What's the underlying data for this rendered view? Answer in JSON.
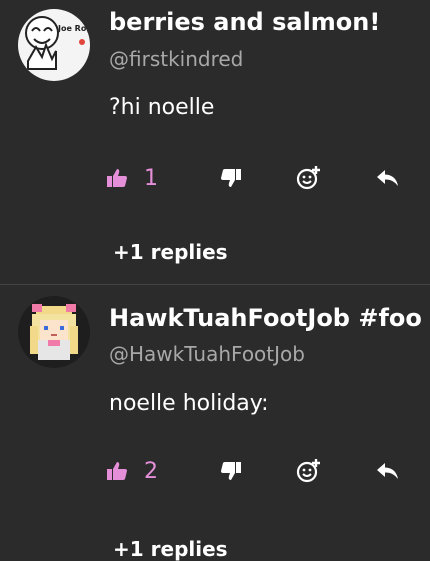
{
  "comments": [
    {
      "name": "berries and salmon!",
      "handle": "@firstkindred",
      "text": "?hi noelle",
      "likes": "1",
      "replies": "+1 replies",
      "avatar_icon": "podcast-logo-avatar",
      "avatar_text": "Joe Rogan Podcast"
    },
    {
      "name": "HawkTuahFootJob #foo",
      "handle": "@HawkTuahFootJob",
      "text": "noelle holiday:",
      "likes": "2",
      "replies": "+1 replies",
      "avatar_icon": "pixel-art-character-avatar"
    }
  ],
  "colors": {
    "background": "#2b2b2b",
    "accent": "#e58fd9",
    "handle": "#a8a8a8"
  }
}
